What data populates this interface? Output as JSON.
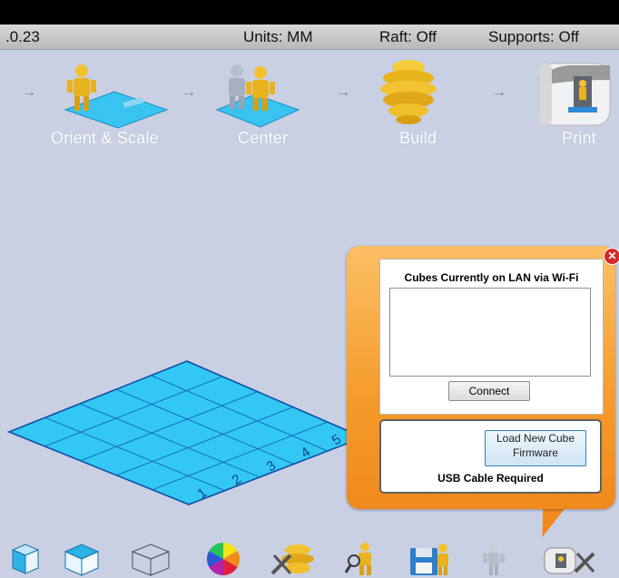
{
  "status_bar": {
    "version": ".0.23",
    "units": "Units: MM",
    "raft": "Raft: Off",
    "supports": "Supports: Off"
  },
  "workflow": {
    "steps": [
      {
        "label": "Orient & Scale",
        "icon": "orient-scale-icon"
      },
      {
        "label": "Center",
        "icon": "center-icon"
      },
      {
        "label": "Build",
        "icon": "build-icon"
      },
      {
        "label": "Print",
        "icon": "printer-icon"
      }
    ],
    "arrow": "→"
  },
  "build_plate": {
    "color": "#33c8f4",
    "axis_labels": [
      "1",
      "2",
      "3",
      "4",
      "5"
    ]
  },
  "lan_dialog": {
    "title": "Cubes Currently on LAN via Wi-Fi",
    "connect_label": "Connect",
    "firmware_label_line1": "Load New Cube",
    "firmware_label_line2": "Firmware",
    "usb_note": "USB Cable Required",
    "close_icon": "close-icon",
    "accent": "#f59a2a"
  },
  "toolbar": {
    "items": [
      {
        "icon": "view-front-icon"
      },
      {
        "icon": "view-top-icon"
      },
      {
        "icon": "view-wireframe-icon"
      },
      {
        "icon": "color-wheel-icon"
      },
      {
        "icon": "build-settings-icon"
      },
      {
        "icon": "inspect-icon"
      },
      {
        "icon": "save-icon"
      },
      {
        "icon": "figure-icon"
      },
      {
        "icon": "printer-settings-icon"
      }
    ]
  }
}
